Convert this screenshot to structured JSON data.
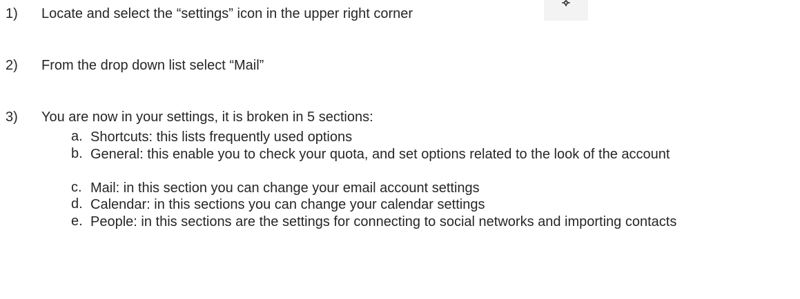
{
  "steps": [
    {
      "number": "1)",
      "text": "Locate and select the “settings” icon in the upper right corner"
    },
    {
      "number": "2)",
      "text": "From the drop down list select “Mail”"
    },
    {
      "number": "3)",
      "text": "You are now in your settings, it is broken in 5 sections:"
    }
  ],
  "sections": [
    {
      "letter": "a.",
      "text": "Shortcuts: this lists frequently used options"
    },
    {
      "letter": "b.",
      "text": "General: this enable you to check your quota, and set options related to the look of the account"
    },
    {
      "letter": "c.",
      "text": "Mail: in this section you can change your email account settings"
    },
    {
      "letter": "d.",
      "text": "Calendar: in this sections you can change your calendar settings"
    },
    {
      "letter": "e.",
      "text": "People: in this sections are the settings for connecting to social networks and importing contacts"
    }
  ],
  "icons": {
    "settings": "gear-icon"
  }
}
